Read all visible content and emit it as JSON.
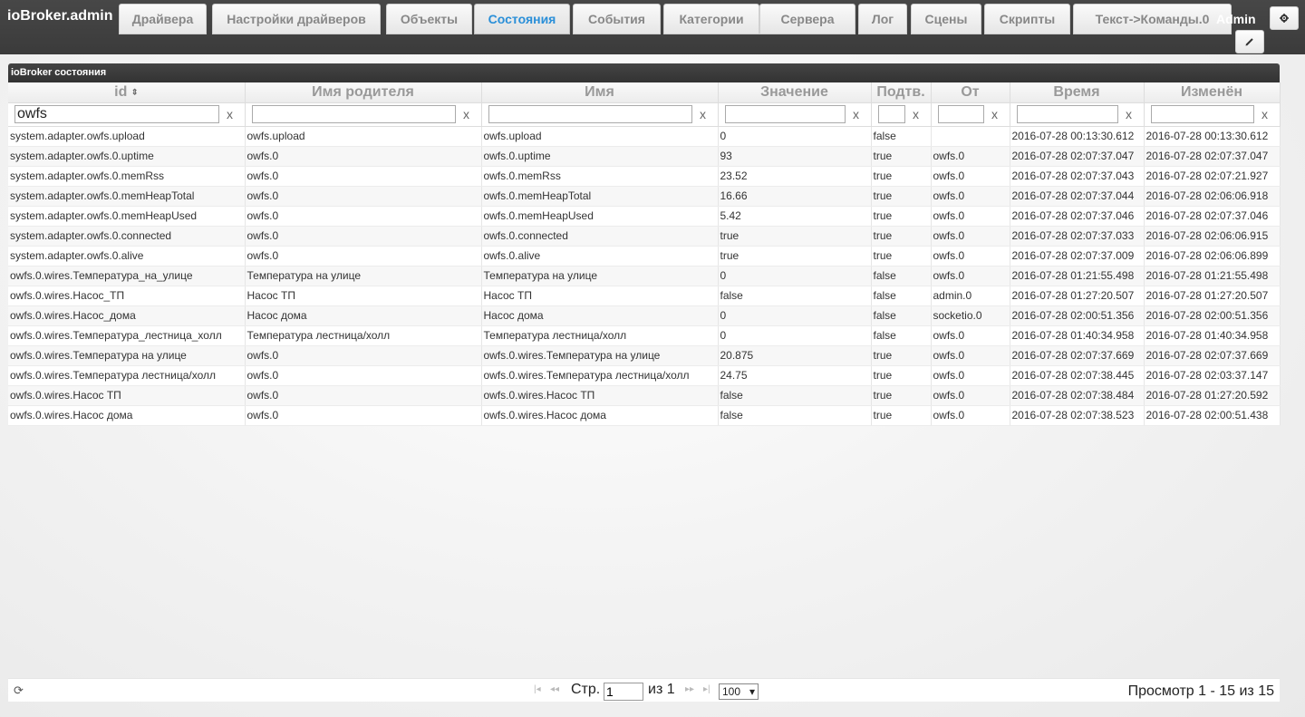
{
  "app": {
    "title": "ioBroker.admin",
    "user": "Admin"
  },
  "tabs": [
    {
      "label": "Драйвера",
      "active": false
    },
    {
      "label": "Настройки драйверов",
      "active": false
    },
    {
      "label": "Объекты",
      "active": false
    },
    {
      "label": "Состояния",
      "active": true
    },
    {
      "label": "События",
      "active": false
    },
    {
      "label": "Категории",
      "active": false
    },
    {
      "label": "Сервера",
      "active": false
    },
    {
      "label": "Лог",
      "active": false
    },
    {
      "label": "Сцены",
      "active": false
    },
    {
      "label": "Скрипты",
      "active": false
    },
    {
      "label": "Текст->Команды.0",
      "active": false
    }
  ],
  "header_icons": {
    "settings": "gear-icon",
    "edit": "pencil-icon"
  },
  "grid": {
    "caption": "ioBroker состояния",
    "sort_icon": "⇕",
    "columns": [
      "id",
      "Имя родителя",
      "Имя",
      "Значение",
      "Подтв.",
      "От",
      "Время",
      "Изменён"
    ],
    "filters": [
      "owfs",
      "",
      "",
      "",
      "",
      "",
      "",
      ""
    ],
    "filter_clear": "x",
    "rows": [
      [
        "system.adapter.owfs.upload",
        "owfs.upload",
        "owfs.upload",
        "0",
        "false",
        "",
        "2016-07-28 00:13:30.612",
        "2016-07-28 00:13:30.612"
      ],
      [
        "system.adapter.owfs.0.uptime",
        "owfs.0",
        "owfs.0.uptime",
        "93",
        "true",
        "owfs.0",
        "2016-07-28 02:07:37.047",
        "2016-07-28 02:07:37.047"
      ],
      [
        "system.adapter.owfs.0.memRss",
        "owfs.0",
        "owfs.0.memRss",
        "23.52",
        "true",
        "owfs.0",
        "2016-07-28 02:07:37.043",
        "2016-07-28 02:07:21.927"
      ],
      [
        "system.adapter.owfs.0.memHeapTotal",
        "owfs.0",
        "owfs.0.memHeapTotal",
        "16.66",
        "true",
        "owfs.0",
        "2016-07-28 02:07:37.044",
        "2016-07-28 02:06:06.918"
      ],
      [
        "system.adapter.owfs.0.memHeapUsed",
        "owfs.0",
        "owfs.0.memHeapUsed",
        "5.42",
        "true",
        "owfs.0",
        "2016-07-28 02:07:37.046",
        "2016-07-28 02:07:37.046"
      ],
      [
        "system.adapter.owfs.0.connected",
        "owfs.0",
        "owfs.0.connected",
        "true",
        "true",
        "owfs.0",
        "2016-07-28 02:07:37.033",
        "2016-07-28 02:06:06.915"
      ],
      [
        "system.adapter.owfs.0.alive",
        "owfs.0",
        "owfs.0.alive",
        "true",
        "true",
        "owfs.0",
        "2016-07-28 02:07:37.009",
        "2016-07-28 02:06:06.899"
      ],
      [
        "owfs.0.wires.Температура_на_улице",
        "Температура на улице",
        "Температура на улице",
        "0",
        "false",
        "owfs.0",
        "2016-07-28 01:21:55.498",
        "2016-07-28 01:21:55.498"
      ],
      [
        "owfs.0.wires.Насос_ТП",
        "Насос ТП",
        "Насос ТП",
        "false",
        "false",
        "admin.0",
        "2016-07-28 01:27:20.507",
        "2016-07-28 01:27:20.507"
      ],
      [
        "owfs.0.wires.Насос_дома",
        "Насос дома",
        "Насос дома",
        "0",
        "false",
        "socketio.0",
        "2016-07-28 02:00:51.356",
        "2016-07-28 02:00:51.356"
      ],
      [
        "owfs.0.wires.Температура_лестница_холл",
        "Температура лестница/холл",
        "Температура лестница/холл",
        "0",
        "false",
        "owfs.0",
        "2016-07-28 01:40:34.958",
        "2016-07-28 01:40:34.958"
      ],
      [
        "owfs.0.wires.Температура на улице",
        "owfs.0",
        "owfs.0.wires.Температура на улице",
        "20.875",
        "true",
        "owfs.0",
        "2016-07-28 02:07:37.669",
        "2016-07-28 02:07:37.669"
      ],
      [
        "owfs.0.wires.Температура лестница/холл",
        "owfs.0",
        "owfs.0.wires.Температура лестница/холл",
        "24.75",
        "true",
        "owfs.0",
        "2016-07-28 02:07:38.445",
        "2016-07-28 02:03:37.147"
      ],
      [
        "owfs.0.wires.Насос ТП",
        "owfs.0",
        "owfs.0.wires.Насос ТП",
        "false",
        "true",
        "owfs.0",
        "2016-07-28 02:07:38.484",
        "2016-07-28 01:27:20.592"
      ],
      [
        "owfs.0.wires.Насос дома",
        "owfs.0",
        "owfs.0.wires.Насос дома",
        "false",
        "true",
        "owfs.0",
        "2016-07-28 02:07:38.523",
        "2016-07-28 02:00:51.438"
      ]
    ]
  },
  "pager": {
    "page_label": "Стр.",
    "page_value": "1",
    "of_label": "из 1",
    "rows_per_page": "100",
    "view_info": "Просмотр 1 - 15 из 15"
  }
}
